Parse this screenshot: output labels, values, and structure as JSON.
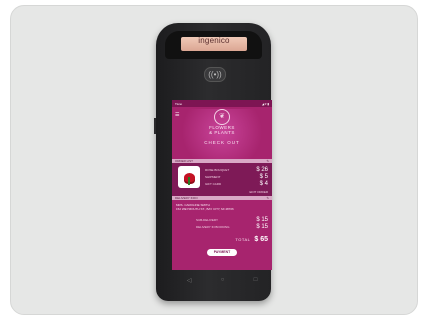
{
  "device": {
    "brand_small": "",
    "brand": "ingenico",
    "nfc_icon": "contactless-icon"
  },
  "status_bar": {
    "left": "Tisno",
    "right": "◢ ▾ ▮"
  },
  "header": {
    "menu_icon": "menu-icon",
    "logo_icon": "leaf-logo-icon",
    "store_line1": "FLOWERS",
    "store_line2": "& PLANTS",
    "checkout": "CHECK OUT"
  },
  "order_section": {
    "title": "ORDER LIST",
    "edit_icon": "edit-icon",
    "items": [
      {
        "label": "ROSE BOUQUET",
        "value": "$ 26"
      },
      {
        "label": "SHIPMENT",
        "value": "$ 5"
      },
      {
        "label": "GIFT CARD",
        "value": "$ 4"
      }
    ],
    "edit_link": "EDIT ORDER"
  },
  "delivery_section": {
    "title": "DELIVERY INFO",
    "edit_icon": "edit-icon",
    "name": "MRS. CAROLINE SMITH",
    "address": "152 WEYMOUTH ST., BAY CITY, MI 48706",
    "fees": [
      {
        "label": "SUB-DELIVERY",
        "value": "$ 15"
      },
      {
        "label": "DELIVERY IN BOOKING",
        "value": "$ 15"
      }
    ],
    "total_label": "TOTAL",
    "total_value": "$ 65",
    "payment_button": "PAYMENT"
  },
  "nav": {
    "back": "◁",
    "home": "○",
    "recent": "□"
  },
  "colors": {
    "accent": "#a7246e",
    "panel": "#7e1a57",
    "copper": "#e0b19f"
  }
}
